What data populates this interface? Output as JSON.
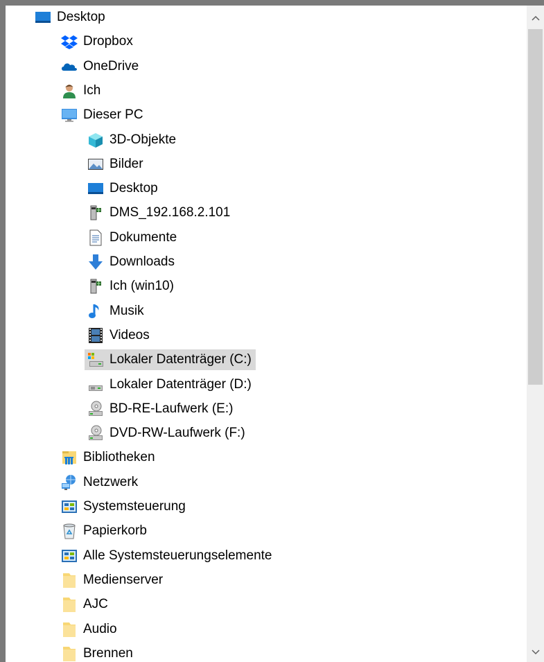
{
  "tree": {
    "items": [
      {
        "label": "Desktop",
        "icon": "desktop-icon",
        "level": 0
      },
      {
        "label": "Dropbox",
        "icon": "dropbox-icon",
        "level": 1
      },
      {
        "label": "OneDrive",
        "icon": "onedrive-icon",
        "level": 1
      },
      {
        "label": "Ich",
        "icon": "user-icon",
        "level": 1
      },
      {
        "label": "Dieser PC",
        "icon": "this-pc-icon",
        "level": 1
      },
      {
        "label": "3D-Objekte",
        "icon": "3d-objects-icon",
        "level": 2
      },
      {
        "label": "Bilder",
        "icon": "pictures-icon",
        "level": 2
      },
      {
        "label": "Desktop",
        "icon": "desktop-icon",
        "level": 2
      },
      {
        "label": "DMS_192.168.2.101",
        "icon": "network-drive-icon",
        "level": 2
      },
      {
        "label": "Dokumente",
        "icon": "documents-icon",
        "level": 2
      },
      {
        "label": "Downloads",
        "icon": "downloads-icon",
        "level": 2
      },
      {
        "label": "Ich (win10)",
        "icon": "network-drive-icon",
        "level": 2
      },
      {
        "label": "Musik",
        "icon": "music-icon",
        "level": 2
      },
      {
        "label": "Videos",
        "icon": "videos-icon",
        "level": 2
      },
      {
        "label": "Lokaler Datenträger (C:)",
        "icon": "system-drive-icon",
        "level": 2,
        "selected": true
      },
      {
        "label": "Lokaler Datenträger (D:)",
        "icon": "local-drive-icon",
        "level": 2
      },
      {
        "label": "BD-RE-Laufwerk (E:)",
        "icon": "optical-drive-icon",
        "level": 2
      },
      {
        "label": "DVD-RW-Laufwerk (F:)",
        "icon": "optical-drive-icon",
        "level": 2
      },
      {
        "label": "Bibliotheken",
        "icon": "libraries-icon",
        "level": 1
      },
      {
        "label": "Netzwerk",
        "icon": "network-icon",
        "level": 1
      },
      {
        "label": "Systemsteuerung",
        "icon": "control-panel-icon",
        "level": 1
      },
      {
        "label": "Papierkorb",
        "icon": "recycle-bin-icon",
        "level": 1
      },
      {
        "label": "Alle Systemsteuerungselemente",
        "icon": "control-panel-icon",
        "level": 1
      },
      {
        "label": "Medienserver",
        "icon": "folder-icon",
        "level": 1
      },
      {
        "label": "AJC",
        "icon": "folder-icon",
        "level": 1
      },
      {
        "label": "Audio",
        "icon": "folder-icon",
        "level": 1
      },
      {
        "label": "Brennen",
        "icon": "folder-icon",
        "level": 1
      }
    ]
  },
  "scrollbar": {
    "up_glyph": "^",
    "down_glyph": "v"
  },
  "colors": {
    "selection": "#d9d9d9",
    "frame": "#7a7a7a",
    "folder": "#f8d775",
    "accent_blue": "#0078d7"
  }
}
